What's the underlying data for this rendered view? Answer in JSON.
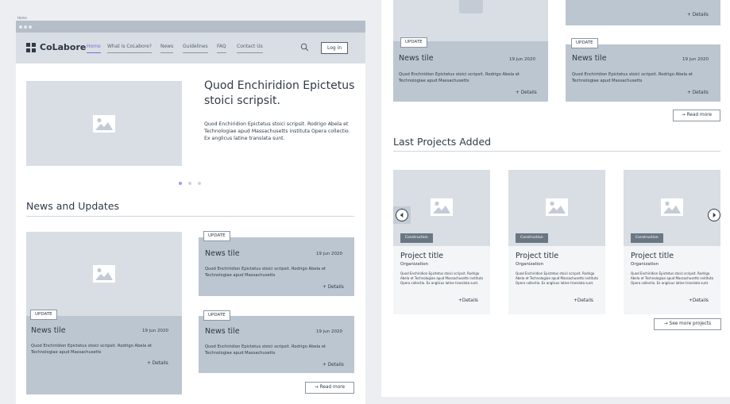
{
  "frame_label": "Home",
  "brand": {
    "name": "CoLabore"
  },
  "nav": {
    "items": [
      {
        "label": "Home",
        "active": true
      },
      {
        "label": "What is CoLabore?",
        "active": false
      },
      {
        "label": "News",
        "active": false
      },
      {
        "label": "Guidelines",
        "active": false
      },
      {
        "label": "FAQ",
        "active": false
      },
      {
        "label": "Contact Us",
        "active": false
      }
    ],
    "search_icon": "search-icon",
    "login_label": "Log in"
  },
  "hero": {
    "title": "Quod Enchiridion Epictetus stoici scripsit.",
    "text": "Quod Enchiridion Epictetus stoici scripsit. Rodrigo Abela et Technologiae apud Massachusetts instituta Opera collectio. Ex anglicus latine translata sunt.",
    "carousel": {
      "count": 3,
      "active": 1
    }
  },
  "news": {
    "section_title": "News and Updates",
    "badge": "UPDATE",
    "tiles": [
      {
        "title": "News tile",
        "date": "19 jun 2020",
        "text": "Quod Enchiridion Epictetus stoici scripsit. Rodrigo Abela et Technologiae apud Massachusetts",
        "details": "+ Details"
      },
      {
        "title": "News tile",
        "date": "19 jun 2020",
        "text": "Quod Enchiridion Epictetus stoici scripsit. Rodrigo Abela et Technologiae apud Massachusetts",
        "details": "+ Details"
      },
      {
        "title": "News tile",
        "date": "19 jun 2020",
        "text": "Quod Enchiridion Epictetus stoici scripsit. Rodrigo Abela et Technologiae apud Massachusetts",
        "details": "+ Details"
      }
    ],
    "read_more": "→ Read more"
  },
  "right_news": {
    "badge": "UPDATE",
    "top_details": "+ Details",
    "tiles": [
      {
        "title": "News tile",
        "date": "19 jun 2020",
        "text": "Quod Enchiridion Epictetus stoici scripsit. Rodrigo Abela et Technologiae apud Massachusetts",
        "details": "+ Details"
      },
      {
        "title": "News tile",
        "date": "19 jun 2020",
        "text": "Quod Enchiridion Epictetus stoici scripsit. Rodrigo Abela et Technologiae apud Massachusetts",
        "details": "+ Details"
      }
    ],
    "read_more": "→ Read more"
  },
  "projects": {
    "section_title": "Last Projects Added",
    "items": [
      {
        "badge": "Construction",
        "title": "Project title",
        "org": "Organization",
        "text": "Quod Enchiridion Epictetus stoici scripsit. Rodrigo Abela et Technologiae apud Massachusetts instituta Opera collectio. Ex anglicus latine translata sunt.",
        "details": "+Details"
      },
      {
        "badge": "Construction",
        "title": "Project title",
        "org": "Organization",
        "text": "Quod Enchiridion Epictetus stoici scripsit. Rodrigo Abela et Technologiae apud Massachusetts instituta Opera collectio. Ex anglicus latine translata sunt.",
        "details": "+Details"
      },
      {
        "badge": "Construction",
        "title": "Project title",
        "org": "Organization",
        "text": "Quod Enchiridion Epictetus stoici scripsit. Rodrigo Abela et Technologiae apud Massachusetts instituta Opera collectio. Ex anglicus latine translata sunt.",
        "details": "+Details"
      }
    ],
    "prev_icon": "chevron-left-icon",
    "next_icon": "chevron-right-icon",
    "see_more": "→ See more projects"
  },
  "colors": {
    "accent": "#7a6fd6",
    "card": "#bcc6d0",
    "placeholder": "#d9dee4",
    "badge_dark": "#6b7683"
  }
}
